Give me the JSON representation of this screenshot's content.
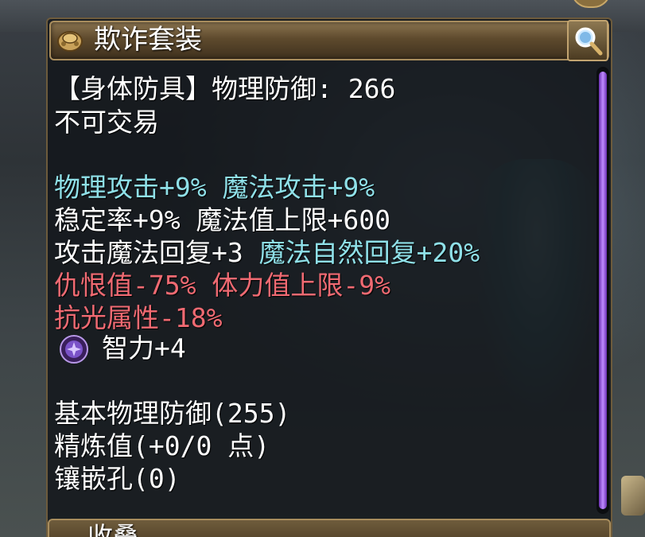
{
  "item": {
    "name": "欺诈套装",
    "type_line": "【身体防具】物理防御: 266",
    "trade_status": "不可交易"
  },
  "stats": [
    {
      "segments": [
        {
          "text": "物理攻击+9% ",
          "color": "cyan"
        },
        {
          "text": "魔法攻击+9%",
          "color": "cyan"
        }
      ]
    },
    {
      "segments": [
        {
          "text": "稳定率+9% ",
          "color": "white"
        },
        {
          "text": "魔法值上限+600",
          "color": "white"
        }
      ]
    },
    {
      "segments": [
        {
          "text": "攻击魔法回复+3 ",
          "color": "white"
        },
        {
          "text": "魔法自然回复+20%",
          "color": "cyan"
        }
      ]
    },
    {
      "segments": [
        {
          "text": "仇恨值-75% ",
          "color": "red"
        },
        {
          "text": "体力值上限-9%",
          "color": "red"
        }
      ]
    },
    {
      "segments": [
        {
          "text": "抗光属性-18%",
          "color": "red"
        }
      ]
    }
  ],
  "gem": {
    "icon": "purple-gem-icon",
    "text": "智力+4"
  },
  "base": {
    "defense": "基本物理防御(255)",
    "refine": "精炼值(+0/0 点)",
    "sockets": "镶嵌孔(0)"
  },
  "footer": {
    "label": "收叠"
  },
  "colors": {
    "cyan": "#8fe0e8",
    "red": "#f06a72",
    "white": "#ffffff",
    "scroll": "#a060f0"
  }
}
